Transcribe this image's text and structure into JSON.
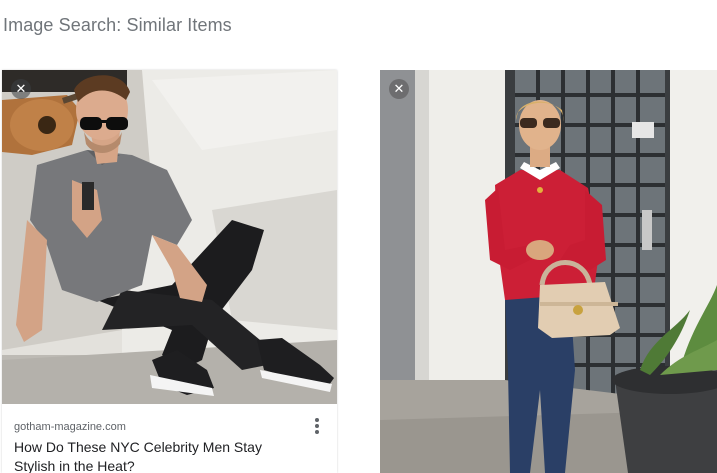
{
  "page": {
    "title": "Image Search: Similar Items"
  },
  "cards": [
    {
      "source": "gotham-magazine.com",
      "caption": "How Do These NYC Celebrity Men Stay Stylish in the Heat?",
      "dismiss_glyph": "✕",
      "icons": [
        "close-icon",
        "more-vert-icon"
      ]
    },
    {
      "dismiss_glyph": "✕",
      "icons": [
        "close-icon"
      ]
    }
  ],
  "colors": {
    "title_text": "#70757a",
    "caption_text": "#202124",
    "source_text": "#5f6368",
    "sweater_red": "#cc1f36"
  }
}
